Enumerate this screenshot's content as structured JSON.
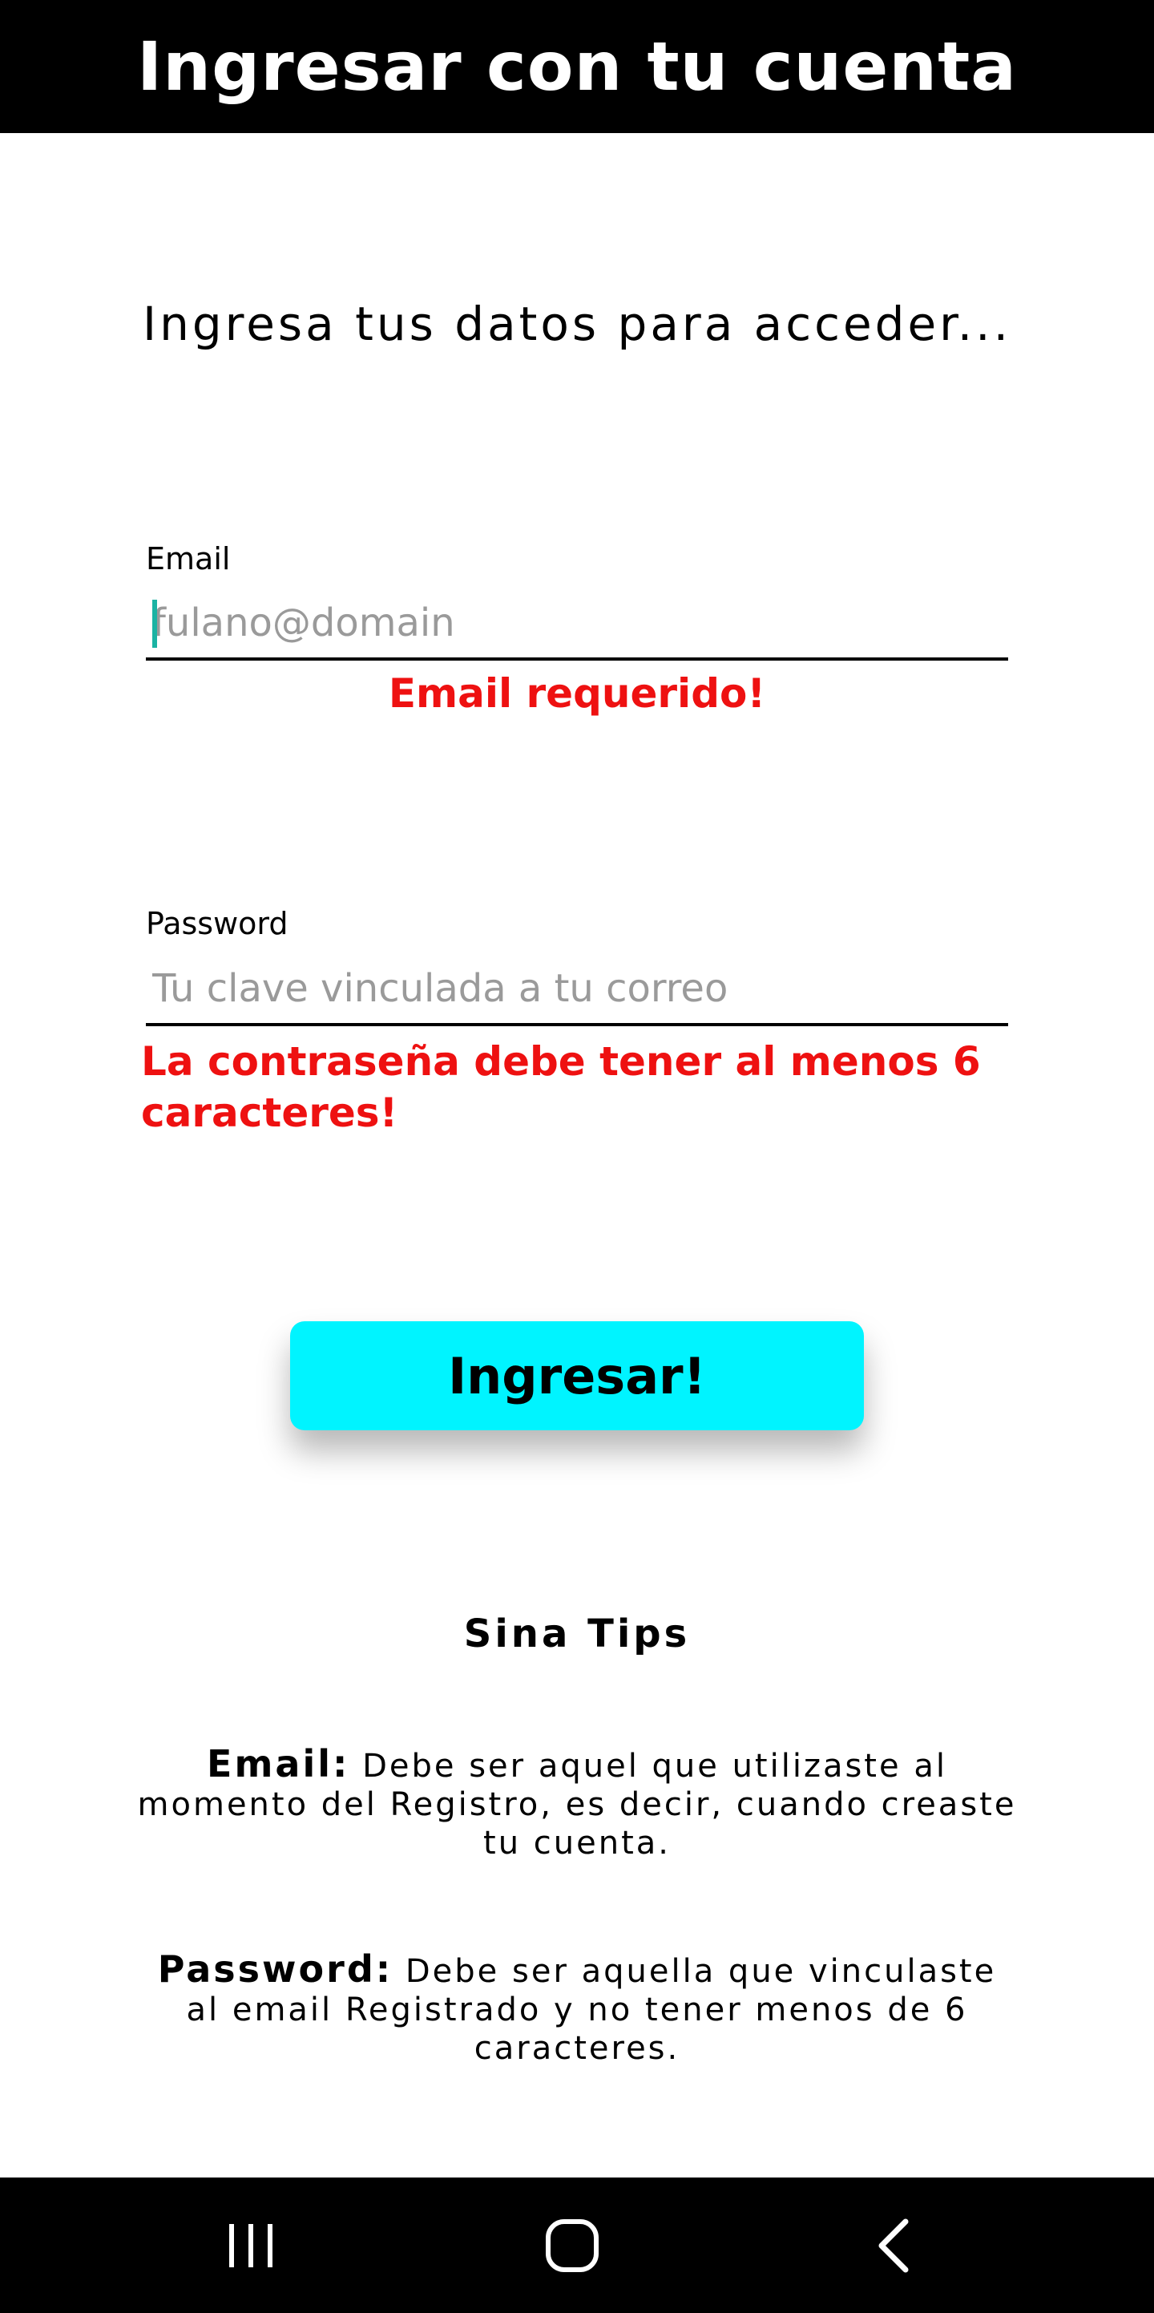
{
  "header": {
    "title": "Ingresar con tu cuenta"
  },
  "intro": {
    "text": "Ingresa tus datos para acceder..."
  },
  "email_field": {
    "label": "Email",
    "placeholder": "fulano@domain",
    "value": "",
    "error": "Email requerido!"
  },
  "password_field": {
    "label": "Password",
    "placeholder": "Tu clave vinculada a tu correo",
    "value": "",
    "error": "La contraseña debe tener al menos 6 caracteres!"
  },
  "submit_button": {
    "label": "Ingresar!"
  },
  "tips": {
    "title": "Sina Tips",
    "items": [
      {
        "key": "Email:",
        "text": " Debe ser aquel que utilizaste al momento del Registro, es decir, cuando creaste tu cuenta."
      },
      {
        "key": "Password:",
        "text": " Debe ser aquella que vinculaste al email Registrado y no tener menos de 6 caracteres."
      }
    ]
  },
  "nav_bar": {
    "buttons": [
      {
        "icon": "recent-apps-icon"
      },
      {
        "icon": "home-icon"
      },
      {
        "icon": "back-icon"
      }
    ]
  },
  "colors": {
    "header_bg": "#000000",
    "button_bg": "#00f4ff",
    "error": "#ee1111",
    "placeholder": "#9a9a9a",
    "cursor": "#1bb3a3"
  }
}
